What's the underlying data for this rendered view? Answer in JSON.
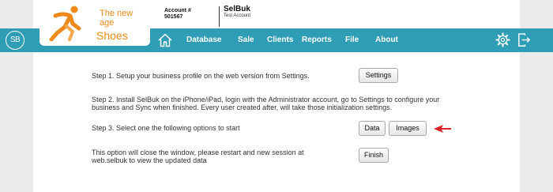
{
  "brand": {
    "tagline": "The new age",
    "name": "Shoes"
  },
  "account": {
    "label": "Account #",
    "number": "501567"
  },
  "company": {
    "name": "SelBuk",
    "subtitle": "Test Account"
  },
  "app_logo": "SB",
  "nav": {
    "items": [
      {
        "label": "Database"
      },
      {
        "label": "Sale"
      },
      {
        "label": "Clients"
      },
      {
        "label": "Reports"
      },
      {
        "label": "File"
      },
      {
        "label": "About"
      }
    ]
  },
  "steps": {
    "step1": "Step 1. Setup your business profile on the web version from Settings.",
    "step2_line1": "Step 2. Install SelBuk on the iPhone/iPad, login with the Administrator account, go to Settings to configure your",
    "step2_line2": "business and Sync when finished. Every user created after, will take those initialization settings.",
    "step3": "Step 3. Select one the following options to start",
    "finish_line1": "This option will close the window, please restart and new session at",
    "finish_line2": "web.selbuk to view the updated data"
  },
  "buttons": {
    "settings": "Settings",
    "data": "Data",
    "images": "Images",
    "finish": "Finish"
  },
  "colors": {
    "nav": "#2f9db5",
    "brand": "#f08a1c",
    "arrow": "#d8232a"
  },
  "icons": [
    "runner-logo-icon",
    "home-icon",
    "gear-icon",
    "exit-icon",
    "arrow-pointer-icon"
  ]
}
